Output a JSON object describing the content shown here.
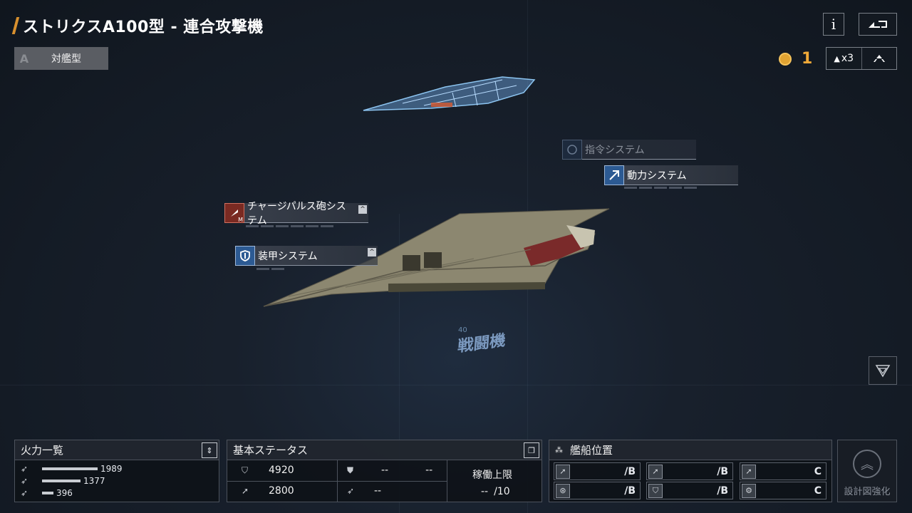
{
  "header": {
    "title": "ストリクスA100型 - 連合攻撃機",
    "type_grade": "A",
    "type_label": "対艦型",
    "info_icon": "i",
    "back_icon": "back-icon"
  },
  "resources": {
    "coin_count": "1",
    "multiplier": "x3",
    "upgrade_icon": "chevron-up-icon"
  },
  "systems": {
    "command": "指令システム",
    "power": "動力システム",
    "charge_pulse": "チャージパルス砲システム",
    "charge_pulse_badge": "M",
    "armor": "装甲システム"
  },
  "ship": {
    "class_label": "戦闘機",
    "class_number": "40"
  },
  "firepower": {
    "title": "火力一覧",
    "rows": [
      {
        "value": "1989",
        "ratio": 1.0
      },
      {
        "value": "1377",
        "ratio": 0.69
      },
      {
        "value": "396",
        "ratio": 0.2
      }
    ]
  },
  "status": {
    "title": "基本ステータス",
    "hp": "4920",
    "speed": "2800",
    "shield_a": "--",
    "shield_b": "--",
    "deploy": "--",
    "limit_label": "稼働上限",
    "limit_value": "--",
    "limit_max": "/10"
  },
  "position": {
    "title": "艦船位置",
    "cells": [
      {
        "grade": "/B"
      },
      {
        "grade": "/B"
      },
      {
        "grade": "C"
      },
      {
        "grade": "/B"
      },
      {
        "grade": "/B"
      },
      {
        "grade": "C"
      }
    ]
  },
  "enhance": {
    "label": "設計図強化"
  },
  "colors": {
    "accent": "#f0a938",
    "system_blue": "#2c5a93",
    "system_red": "#7a2a22"
  }
}
